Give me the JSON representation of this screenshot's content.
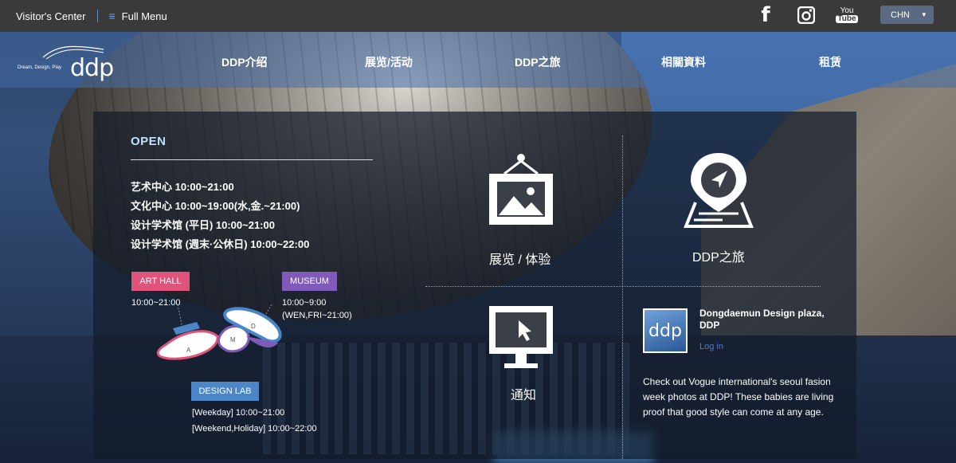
{
  "topbar": {
    "visitors_center": "Visitor's Center",
    "full_menu": "Full Menu",
    "facebook_glyph": "f",
    "youtube_top": "You",
    "youtube_bottom": "Tube",
    "language": "CHN"
  },
  "logo": {
    "tagline": "Dream, Design, Play",
    "wordmark": "ddp"
  },
  "nav": {
    "items": [
      "DDP介绍",
      "展览/活动",
      "DDP之旅",
      "相關資料",
      "租赁"
    ]
  },
  "hours": {
    "title": "OPEN",
    "lines": [
      "艺术中心 10:00~21:00",
      "文化中心 10:00~19:00(水,金.~21:00)",
      "设计学术馆 (平日) 10:00~21:00",
      "设计学术馆 (週末·公休日) 10:00~22:00"
    ]
  },
  "venues": {
    "art_hall": {
      "label": "ART HALL",
      "time": "10:00~21:00"
    },
    "museum": {
      "label": "MUSEUM",
      "time": "10:00~9:00",
      "note": "(WEN,FRI~21:00)"
    },
    "design_lab": {
      "label": "DESIGN LAB",
      "weekday": "[Weekday] 10:00~21:00",
      "weekend": "[Weekend,Holiday] 10:00~22:00"
    },
    "map_letters": {
      "a": "A",
      "m": "M",
      "d": "D"
    }
  },
  "tiles": {
    "exhibition": "展览 / 体验",
    "tour": "DDP之旅",
    "notice": "通知"
  },
  "feed": {
    "avatar_text": "ddp",
    "page_name": "Dongdaemun Design plaza, DDP",
    "login": "Log in",
    "post": "Check out Vogue international's seoul fasion week photos at DDP! These babies are living proof that good style can come at any age."
  },
  "colors": {
    "art_hall": "#e0547c",
    "museum": "#7f5ab8",
    "design_lab": "#4a86c8",
    "open_title": "#bfe3ff"
  }
}
